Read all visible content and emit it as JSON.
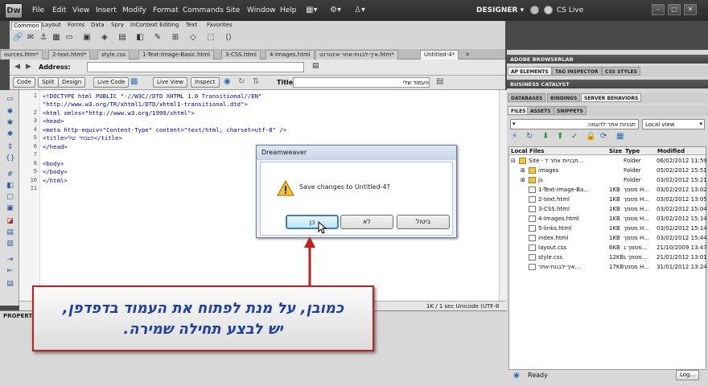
{
  "app": {
    "logo": "Dw",
    "menu": [
      "File",
      "Edit",
      "View",
      "Insert",
      "Modify",
      "Format",
      "Commands",
      "Site",
      "Window",
      "Help"
    ],
    "workspace": "DESIGNER",
    "cs_live": "CS Live",
    "toolbar_icons": [
      "layout-icon",
      "code-view-icon",
      "site-manager-icon",
      "extensions-icon"
    ]
  },
  "insert_bar": {
    "tabs": [
      "Common",
      "Layout",
      "Forms",
      "Data",
      "Spry",
      "InContext Editing",
      "Text",
      "Favorites"
    ],
    "active": "Common"
  },
  "doc_tabs": [
    "ources.htm*",
    "2-text.html*",
    "style.css",
    "1-Text-Image-Basic.html",
    "3-CSS.html",
    "4-Images.html",
    "איך-לבנות-אתר-אינטרנט.htm*",
    "Untitled-4*"
  ],
  "address": {
    "label": "Address:",
    "value": ""
  },
  "view_bar": {
    "code": "Code",
    "split": "Split",
    "design": "Design",
    "live_code": "Live Code",
    "live_view": "Live View",
    "inspect": "Inspect",
    "title_label": "Title:",
    "title_value": "העמוד שלי"
  },
  "code_lines": [
    {
      "n": "1",
      "text": "<!DOCTYPE html PUBLIC \"-//W3C//DTD XHTML 1.0 Transitional//EN\""
    },
    {
      "n": "",
      "text": "\"http://www.w3.org/TR/xhtml1/DTD/xhtml1-transitional.dtd\">"
    },
    {
      "n": "2",
      "text": "<html xmlns=\"http://www.w3.org/1999/xhtml\">"
    },
    {
      "n": "3",
      "text": "<head>"
    },
    {
      "n": "4",
      "text": "<meta http-equiv=\"Content-Type\" content=\"text/html; charset=utf-8\" />"
    },
    {
      "n": "5",
      "text": "<title>העמוד שלי</title>"
    },
    {
      "n": "6",
      "text": "</head>"
    },
    {
      "n": "7",
      "text": ""
    },
    {
      "n": "8",
      "text": "<body>"
    },
    {
      "n": "9",
      "text": "</body>"
    },
    {
      "n": "10",
      "text": "</html>"
    },
    {
      "n": "11",
      "text": ""
    }
  ],
  "status": {
    "info": "1K / 1 sec  Unicode (UTF-8"
  },
  "properties_label": "PROPERT",
  "right_panel": {
    "browserlab": "ADOBE BROWSERLAB",
    "tabs1": [
      "AP ELEMENTS",
      "TAG INSPECTOR",
      "CSS STYLES"
    ],
    "business_catalyst": "BUSINESS CATALYST",
    "tabs2": [
      "DATABASES",
      "BINDINGS",
      "SERVER BEHAVIORS"
    ],
    "tabs3": [
      "FILES",
      "ASSETS",
      "SNIPPETS"
    ],
    "site_select": "תבניות אתר לדוגמה",
    "view_select": "Local view",
    "columns": [
      "Local Files",
      "Size",
      "Type",
      "Modified"
    ],
    "files": [
      {
        "name": "Site - תבניות אתר ל...",
        "size": "",
        "type": "Folder",
        "modified": "06/02/2012 11:59",
        "kind": "folder"
      },
      {
        "name": "images",
        "size": "",
        "type": "Folder",
        "modified": "05/02/2012 15:51",
        "kind": "folder"
      },
      {
        "name": "js",
        "size": "",
        "type": "Folder",
        "modified": "03/02/2012 15:21",
        "kind": "folder"
      },
      {
        "name": "1-Text-Image-Ba...",
        "size": "1KB",
        "type": "מסמך H...",
        "modified": "03/02/2012 13:02",
        "kind": "doc"
      },
      {
        "name": "2-text.html",
        "size": "1KB",
        "type": "מסמך H...",
        "modified": "03/02/2012 13:05",
        "kind": "doc"
      },
      {
        "name": "3-CSS.html",
        "size": "1KB",
        "type": "מסמך H...",
        "modified": "03/02/2012 15:04",
        "kind": "doc"
      },
      {
        "name": "4-Images.html",
        "size": "1KB",
        "type": "מסמך H...",
        "modified": "03/02/2012 15:14",
        "kind": "doc"
      },
      {
        "name": "5-links.html",
        "size": "1KB",
        "type": "מסמך H...",
        "modified": "03/02/2012 15:14",
        "kind": "doc"
      },
      {
        "name": "index.html",
        "size": "1KB",
        "type": "מסמך H...",
        "modified": "03/02/2012 15:44",
        "kind": "doc"
      },
      {
        "name": "layout.css",
        "size": "6KB",
        "type": "מסמך ג...",
        "modified": "21/10/2009 13:47",
        "kind": "doc"
      },
      {
        "name": "style.css",
        "size": "12KB",
        "type": "מסמך ג...",
        "modified": "21/01/2012 13:01",
        "kind": "doc"
      },
      {
        "name": "איך-לבנות-אתר...",
        "size": "17KB",
        "type": "מסמך H...",
        "modified": "31/01/2012 13:24",
        "kind": "doc"
      }
    ],
    "ready": "Ready",
    "log_button": "Log..."
  },
  "dialog": {
    "title": "Dreamweaver",
    "message": "Save changes to Untitled-4?",
    "yes": "כן",
    "no": "לא",
    "cancel": "ביטול"
  },
  "callout": {
    "line1": "כמובן, על מנת לפתוח את העמוד בדפדפן,",
    "line2": "יש לבצע תחילה שמירה."
  },
  "colors": {
    "callout_border": "#c02020",
    "callout_text": "#1f3fa8",
    "arrow": "#c02020"
  }
}
